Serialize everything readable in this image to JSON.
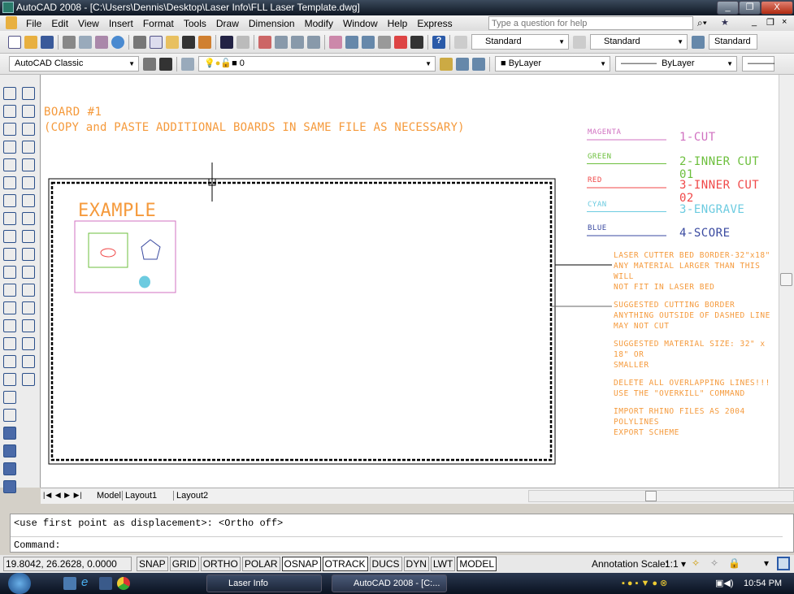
{
  "window": {
    "title": "AutoCAD 2008 - [C:\\Users\\Dennis\\Desktop\\Laser Info\\FLL Laser Template.dwg]",
    "minimize": "_",
    "restore": "❐",
    "close": "X"
  },
  "menu": [
    "File",
    "Edit",
    "View",
    "Insert",
    "Format",
    "Tools",
    "Draw",
    "Dimension",
    "Modify",
    "Window",
    "Help",
    "Express"
  ],
  "help_placeholder": "Type a question for help",
  "toolbar1": {
    "text_style": "Standard",
    "dim_style": "Standard",
    "table_style": "Standard"
  },
  "toolbar2": {
    "workspace": "AutoCAD Classic",
    "layer": "0",
    "color": "ByLayer",
    "linetype": "ByLayer"
  },
  "drawing": {
    "board_title": "BOARD #1",
    "board_note": "(COPY and PASTE ADDITIONAL BOARDS IN SAME FILE AS NECESSARY)",
    "example_label": "EXAMPLE",
    "legend": [
      {
        "color_name": "MAGENTA",
        "label": "1-CUT",
        "color": "#d070c0"
      },
      {
        "color_name": "GREEN",
        "label": "2-INNER CUT 01",
        "color": "#6cbf3c"
      },
      {
        "color_name": "RED",
        "label": "3-INNER CUT 02",
        "color": "#f04848"
      },
      {
        "color_name": "CYAN",
        "label": "3-ENGRAVE",
        "color": "#6ccbe0"
      },
      {
        "color_name": "BLUE",
        "label": "4-SCORE",
        "color": "#3a4aa0"
      }
    ],
    "notes": [
      [
        "LASER CUTTER BED BORDER-32\"x18\"",
        "ANY MATERIAL LARGER THAN THIS WILL",
        "NOT FIT IN LASER BED"
      ],
      [
        "SUGGESTED CUTTING BORDER",
        "ANYTHING OUTSIDE OF DASHED LINE",
        "MAY NOT CUT"
      ],
      [
        "SUGGESTED MATERIAL SIZE: 32\" x 18\" OR",
        "SMALLER"
      ],
      [
        "DELETE ALL OVERLAPPING LINES!!!",
        "USE THE \"OVERKILL\" COMMAND"
      ],
      [
        "IMPORT RHINO FILES AS 2004 POLYLINES",
        "EXPORT SCHEME"
      ]
    ],
    "text_color": "#f59a3c"
  },
  "tabs": [
    "Model",
    "Layout1",
    "Layout2"
  ],
  "command": {
    "history": "<use first point as displacement>:  <Ortho off>",
    "prompt": "Command:"
  },
  "status": {
    "coords": "19.8042, 26.2628, 0.0000",
    "toggles": [
      {
        "label": "SNAP",
        "on": false
      },
      {
        "label": "GRID",
        "on": false
      },
      {
        "label": "ORTHO",
        "on": false
      },
      {
        "label": "POLAR",
        "on": false
      },
      {
        "label": "OSNAP",
        "on": true
      },
      {
        "label": "OTRACK",
        "on": true
      },
      {
        "label": "DUCS",
        "on": false
      },
      {
        "label": "DYN",
        "on": false
      },
      {
        "label": "LWT",
        "on": false
      },
      {
        "label": "MODEL",
        "on": true
      }
    ],
    "annotation_scale_label": "Annotation Scale:",
    "annotation_scale": "1:1"
  },
  "taskbar": {
    "tasks": [
      "Laser Info",
      "AutoCAD 2008 - [C:..."
    ],
    "clock": "10:54 PM"
  }
}
